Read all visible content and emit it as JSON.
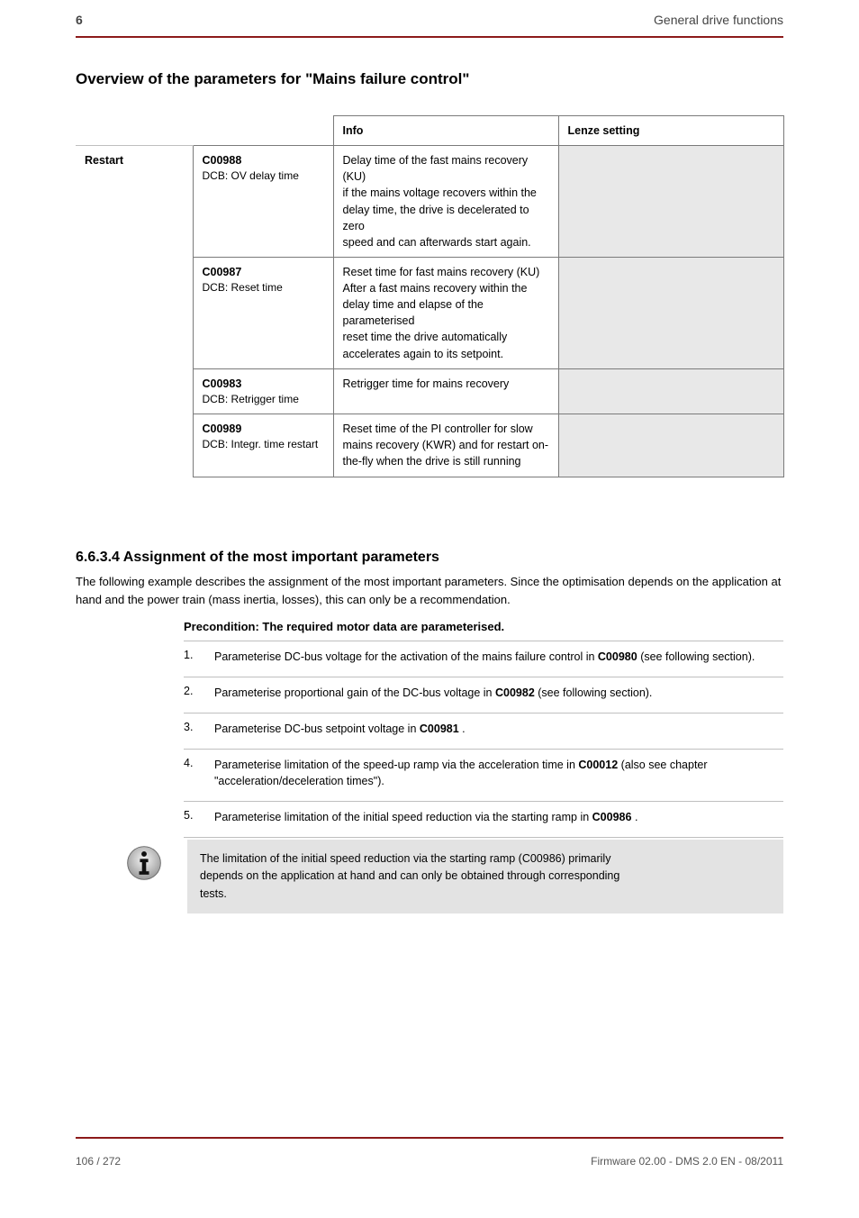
{
  "header": {
    "section": "6",
    "running_title": "General drive functions"
  },
  "heading": "Overview of the parameters for \"Mains failure control\"",
  "table": {
    "headers": {
      "col3": "Info",
      "col4": "Lenze setting"
    },
    "rows": [
      {
        "group": "Restart",
        "param": "C00988",
        "param_sub": "DCB: OV delay time",
        "desc_line1": "Delay time of the fast mains recovery",
        "desc_line2": "(KU)",
        "desc_line3": "if the mains voltage recovers within the",
        "desc_line4": "delay time, the drive is decelerated to zero",
        "desc_line5": "speed and can afterwards start again.",
        "desc_line6": ""
      },
      {
        "group": "",
        "param": "C00987",
        "param_sub": "DCB: Reset time",
        "desc_line1": "Reset time for fast mains recovery (KU)",
        "desc_line2": "After a fast mains recovery within the",
        "desc_line3": "delay time and elapse of the parameterised",
        "desc_line4": "reset time the drive automatically",
        "desc_line5": "accelerates again to its setpoint."
      },
      {
        "group": "",
        "param": "C00983",
        "param_sub": "DCB: Retrigger time",
        "desc_line1": "Retrigger time for mains recovery"
      },
      {
        "group": "",
        "param": "C00989",
        "param_sub": "DCB: Integr. time restart",
        "desc_line1": "Reset time of the PI controller for slow",
        "desc_line2": "mains recovery (KWR) and for restart on-",
        "desc_line3": "the-fly when the drive is still running"
      }
    ]
  },
  "assignment": {
    "title": "6.6.3.4  Assignment of the most important parameters",
    "intro": "The following example describes the assignment of the most important parameters. Since the optimisation depends on the application at hand and the power train (mass inertia, losses), this can only be a recommendation.",
    "precondition": "Precondition: The required motor data are parameterised.",
    "steps": [
      {
        "num": "1.",
        "pre": "Parameterise DC-bus voltage for the activation of the mains failure control in ",
        "bold": "C00980",
        "post": " (see following section)."
      },
      {
        "num": "2.",
        "pre": "Parameterise proportional gain of the DC-bus voltage in ",
        "bold": "C00982",
        "post": " (see following section)."
      },
      {
        "num": "3.",
        "pre": "Parameterise DC-bus setpoint voltage in ",
        "bold": "C00981",
        "post": "."
      },
      {
        "num": "4.",
        "pre": "Parameterise limitation of the speed-up ramp via the acceleration time in ",
        "bold": "C00012",
        "post": " (also see chapter \"acceleration/deceleration times\")."
      },
      {
        "num": "5.",
        "pre": "Parameterise limitation of the initial speed reduction via the starting ramp in ",
        "bold": "C00986",
        "post": "."
      }
    ],
    "info_line1": "The limitation of the initial speed reduction via the starting ramp (C00986) primarily",
    "info_line2": "depends on the application at hand and can only be obtained through corresponding",
    "info_line3": "tests."
  },
  "footer": {
    "page_of": "106 / 272",
    "doc_id": "Firmware 02.00 - DMS 2.0 EN - 08/2011"
  }
}
